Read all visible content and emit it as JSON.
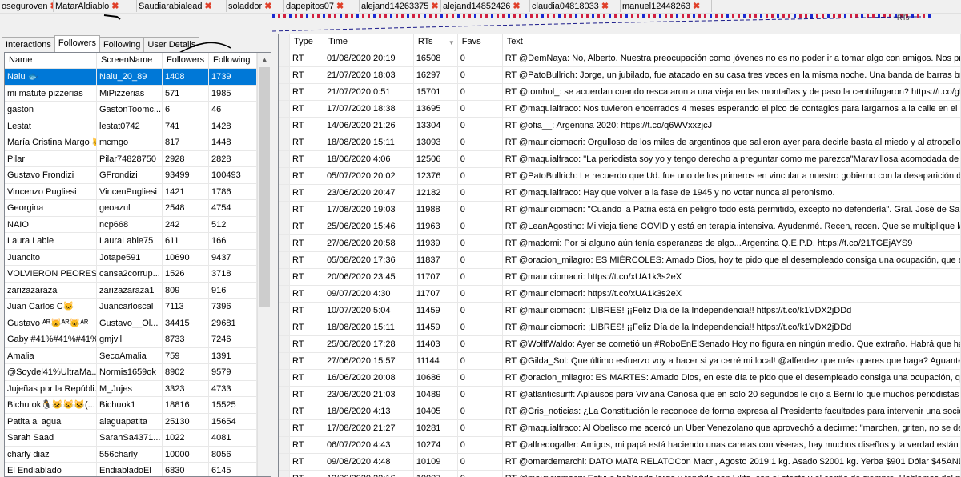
{
  "top_tabs": [
    {
      "label": "oseguroven",
      "close": "✖"
    },
    {
      "label": "MatarAldiablo",
      "close": "✖"
    },
    {
      "label": "Saudiarabialead",
      "close": "✖"
    },
    {
      "label": "soladdor",
      "close": "✖"
    },
    {
      "label": "dapepitos07",
      "close": "✖"
    },
    {
      "label": "alejand14263375",
      "close": "✖"
    },
    {
      "label": "alejand14852426",
      "close": "✖"
    },
    {
      "label": "claudia04818033",
      "close": "✖"
    },
    {
      "label": "manuel12448263",
      "close": "✖"
    }
  ],
  "graph_strip": {
    "label": "RTs"
  },
  "left": {
    "tabs": [
      "Interactions",
      "Followers",
      "Following",
      "User Details"
    ],
    "active_tab": "Followers",
    "columns": [
      "Name",
      "ScreenName",
      "Followers",
      "Following"
    ],
    "rows": [
      [
        "Nalu 🐟",
        "Nalu_20_89",
        "1408",
        "1739"
      ],
      [
        "mi matute pizzerias",
        "MiPizzerias",
        "571",
        "1985"
      ],
      [
        "gaston",
        "GastonToomc...",
        "6",
        "46"
      ],
      [
        "Lestat",
        "lestat0742",
        "741",
        "1428"
      ],
      [
        "María Cristina Margo 🐱",
        "mcmgo",
        "817",
        "1448"
      ],
      [
        "Pilar",
        "Pilar74828750",
        "2928",
        "2828"
      ],
      [
        "Gustavo Frondizi",
        "GFrondizi",
        "93499",
        "100493"
      ],
      [
        "Vincenzo Pugliesi",
        "VincenPugliesi",
        "1421",
        "1786"
      ],
      [
        "Georgina",
        "geoazul",
        "2548",
        "4754"
      ],
      [
        "NAIO",
        "ncp668",
        "242",
        "512"
      ],
      [
        "Laura Lable",
        "LauraLable75",
        "611",
        "166"
      ],
      [
        "Juancito",
        "Jotape591",
        "10690",
        "9437"
      ],
      [
        "VOLVIERON PEORES",
        "cansa2corrup...",
        "1526",
        "3718"
      ],
      [
        "zarizazaraza",
        "zarizazaraza1",
        "809",
        "916"
      ],
      [
        "Juan Carlos C🐱",
        "Juancarloscal",
        "7113",
        "7396"
      ],
      [
        "Gustavo ᴬᴿ🐱ᴬᴿ🐱ᴬᴿ",
        "Gustavo__Ol...",
        "34415",
        "29681"
      ],
      [
        "Gaby #41%#41%#41%",
        "gmjvil",
        "8733",
        "7246"
      ],
      [
        "Amalia",
        "SecoAmalia",
        "759",
        "1391"
      ],
      [
        "@Soydel41%UltraMa...",
        "Normis1659ok",
        "8902",
        "9579"
      ],
      [
        "Jujeñas por la Repúbli...",
        "M_Jujes",
        "3323",
        "4733"
      ],
      [
        "Bichu ok🐧😺😺😺(...",
        "Bichuok1",
        "18816",
        "15525"
      ],
      [
        "Patita al agua",
        "alaguapatita",
        "25130",
        "15654"
      ],
      [
        "Sarah Saad",
        "SarahSa4371...",
        "1022",
        "4081"
      ],
      [
        "charly diaz",
        "556charly",
        "10000",
        "8056"
      ],
      [
        "El Endiablado",
        "EndiabladoEl",
        "6830",
        "6145"
      ]
    ]
  },
  "right": {
    "columns": [
      "Type",
      "Time",
      "RTs",
      "Favs",
      "Text"
    ],
    "sort_indicator": "▼",
    "rows": [
      [
        "RT",
        "01/08/2020 20:19",
        "16508",
        "0",
        "RT @DemNaya: No, Alberto. Nuestra preocupación como jóvenes no es no poder ir a tomar algo con amigos. Nos preocupa l"
      ],
      [
        "RT",
        "21/07/2020 18:03",
        "16297",
        "0",
        "RT @PatoBullrich: Jorge, un jubilado, fue atacado en su casa tres veces en la misma noche. Una banda de barras bravas le f"
      ],
      [
        "RT",
        "21/07/2020 0:51",
        "15701",
        "0",
        "RT @tomhol_: se acuerdan cuando rescataron a una vieja en las montañas y de paso la centrifugaron?  https://t.co/gNL5eX"
      ],
      [
        "RT",
        "17/07/2020 18:38",
        "13695",
        "0",
        "RT @maquialfraco: Nos tuvieron encerrados 4 meses esperando el pico de contagios para largarnos a la calle en el pico de c"
      ],
      [
        "RT",
        "14/06/2020 21:26",
        "13304",
        "0",
        "RT @ofia__: Argentina 2020: https://t.co/q6WVxxzjcJ"
      ],
      [
        "RT",
        "18/08/2020 15:11",
        "13093",
        "0",
        "RT @mauriciomacri: Orgulloso de los miles de argentinos que salieron ayer para decirle basta al miedo y al atropello, y sí al trab"
      ],
      [
        "RT",
        "18/06/2020 4:06",
        "12506",
        "0",
        "RT @maquialfraco: \"La periodista soy yo y tengo derecho a preguntar como me parezca\"Maravillosa acomodada de @cris_no"
      ],
      [
        "RT",
        "05/07/2020 20:02",
        "12376",
        "0",
        "RT @PatoBullrich: Le recuerdo que Ud. fue uno de los primeros en vincular a nuestro gobierno con la desaparición de Maldon"
      ],
      [
        "RT",
        "23/06/2020 20:47",
        "12182",
        "0",
        "RT @maquialfraco: Hay que volver a la fase de 1945 y no votar nunca al peronismo."
      ],
      [
        "RT",
        "17/08/2020 19:03",
        "11988",
        "0",
        "RT @mauriciomacri: \"Cuando la Patria está en peligro todo está permitido, excepto no defenderla\". Gral. José de San Martín #1"
      ],
      [
        "RT",
        "25/06/2020 15:46",
        "11963",
        "0",
        "RT @LeanAgostino: Mi vieja tiene COVID y está en terapia intensiva. Ayudenmé. Recen, recen. Que se multiplique la cadena"
      ],
      [
        "RT",
        "27/06/2020 20:58",
        "11939",
        "0",
        "RT @madomi: Por si alguno aún tenía esperanzas de algo...Argentina Q.E.P.D. https://t.co/21TGEjAYS9"
      ],
      [
        "RT",
        "05/08/2020 17:36",
        "11837",
        "0",
        "RT @oracion_milagro: ES MIÉRCOLES: Amado Dios, hoy te pido que el desempleado consiga una ocupación, que el enfermo"
      ],
      [
        "RT",
        "20/06/2020 23:45",
        "11707",
        "0",
        "RT @mauriciomacri: https://t.co/xUA1k3s2eX"
      ],
      [
        "RT",
        "09/07/2020 4:30",
        "11707",
        "0",
        "RT @mauriciomacri: https://t.co/xUA1k3s2eX"
      ],
      [
        "RT",
        "10/07/2020 5:04",
        "11459",
        "0",
        "RT @mauriciomacri: ¡LIBRES! ¡¡Feliz Día de la Independencia!! https://t.co/k1VDX2jDDd"
      ],
      [
        "RT",
        "18/08/2020 15:11",
        "11459",
        "0",
        "RT @mauriciomacri: ¡LIBRES! ¡¡Feliz Día de la Independencia!! https://t.co/k1VDX2jDDd"
      ],
      [
        "RT",
        "25/06/2020 17:28",
        "11403",
        "0",
        "RT @WolffWaldo: Ayer se cometió un #RoboEnElSenado Hoy no figura en ningún medio. Que extraño. Habrá que hacerlo #"
      ],
      [
        "RT",
        "27/06/2020 15:57",
        "11144",
        "0",
        "RT @Gilda_Sol: Que último esfuerzo voy a hacer si ya cerré mi local! @alferdez que más queres que haga? Aguante 100 días,"
      ],
      [
        "RT",
        "16/06/2020 20:08",
        "10686",
        "0",
        "RT @oracion_milagro: ES MARTES: Amado Dios, en este día te pido que el desempleado consiga una ocupación, que el enf"
      ],
      [
        "RT",
        "23/06/2020 21:03",
        "10489",
        "0",
        "RT @atlanticsurff: Aplausos para Viviana Canosa que en solo 20 segundos le dijo a Berni lo que muchos periodistas llora pauta"
      ],
      [
        "RT",
        "18/06/2020 4:13",
        "10405",
        "0",
        "RT @Cris_noticias: ¿La Constitución le reconoce de forma expresa al Presidente facultades para intervenir una sociedad? No"
      ],
      [
        "RT",
        "17/08/2020 21:27",
        "10281",
        "0",
        "RT @maquialfraco: Al Obelisco me acercó un Uber Venezolano que aprovechó a decirme: \"marchen, griten, no se dejen estar"
      ],
      [
        "RT",
        "06/07/2020 4:43",
        "10274",
        "0",
        "RT @alfredogaller: Amigos, mi papá está haciendo unas caretas con viseras, hay muchos diseños y la verdad están muy funci"
      ],
      [
        "RT",
        "09/08/2020 4:48",
        "10109",
        "0",
        "RT @omardemarchi: DATO MATA RELATOCon Macri, Agosto 2019:1 kg. Asado $2001 kg. Yerba  $901 Dólar $45ANDATE"
      ],
      [
        "RT",
        "13/06/2020 22:16",
        "10007",
        "0",
        "RT @mauriciomacri: Estuve hablando largo y tendido con Lilita, con el afecto y el cariño de siempre. Hablamos del momento q"
      ]
    ]
  }
}
